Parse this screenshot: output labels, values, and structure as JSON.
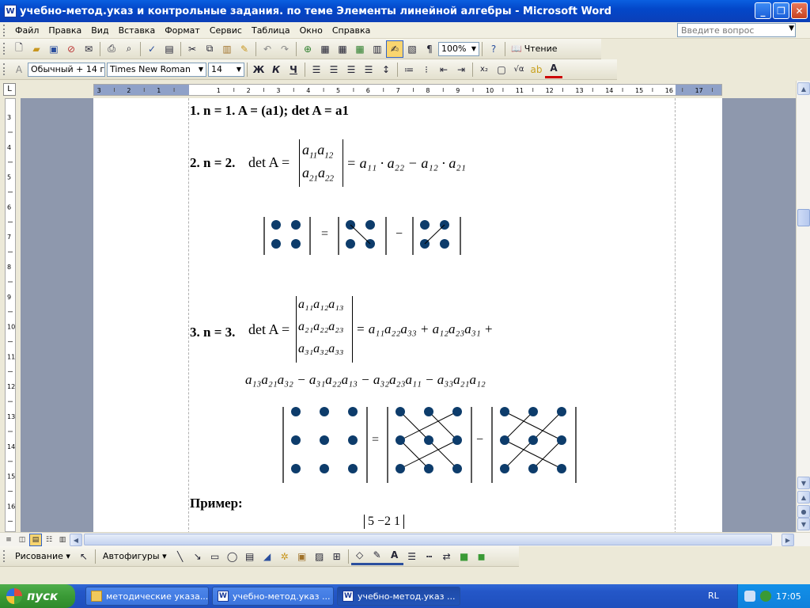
{
  "window": {
    "title": "учебно-метод.указ и контрольные задания. по теме Элементы линейной алгебры - Microsoft Word",
    "icon_letter": "W",
    "minimize": "_",
    "maximize": "❐",
    "close": "✕"
  },
  "menu": {
    "items": [
      "Файл",
      "Правка",
      "Вид",
      "Вставка",
      "Формат",
      "Сервис",
      "Таблица",
      "Окно",
      "Справка"
    ],
    "ask_placeholder": "Введите вопрос"
  },
  "standard_toolbar": {
    "zoom": "100%",
    "read_label": "Чтение"
  },
  "formatting_toolbar": {
    "style": "Обычный + 14 г",
    "font": "Times New Roman",
    "size": "14",
    "bold": "Ж",
    "italic": "К",
    "underline": "Ч",
    "font_color_letter": "A"
  },
  "ruler": {
    "corner": "L",
    "h_labels": [
      "3",
      "2",
      "1",
      "1",
      "2",
      "3",
      "4",
      "5",
      "6",
      "7",
      "8",
      "9",
      "10",
      "11",
      "12",
      "13",
      "14",
      "15",
      "16",
      "17"
    ],
    "v_labels": [
      "3",
      "4",
      "5",
      "6",
      "7",
      "8",
      "9",
      "10",
      "11",
      "12",
      "13",
      "14",
      "15",
      "16"
    ]
  },
  "document": {
    "line1": "1. n = 1. A = (a1); det A = a1",
    "item2_label": "2. n = 2.",
    "det_prefix": "det A =",
    "m2": [
      "a",
      "11",
      "a",
      "12",
      "a",
      "21",
      "a",
      "22"
    ],
    "formula2": "= a₁₁ · a₂₂ − a₁₂ · a₂₁",
    "item3_label": "3. n = 3.",
    "m3_row1": "a₁₁a₁₂a₁₃",
    "m3_row2": "a₂₁a₂₂a₂₃",
    "m3_row3": "a₃₁a₃₂a₃₃",
    "formula3a": "= a₁₁a₂₂a₃₃ + a₁₂a₂₃a₃₁ +",
    "formula3b": "a₁₃a₂₁a₃₂ − a₃₁a₂₂a₁₃ − a₃₂a₂₃a₁₁ − a₃₃a₂₁a₁₂",
    "equals": "=",
    "minus": "−",
    "example_label": "Пример:",
    "example_row": "5   −2    1"
  },
  "drawing_toolbar": {
    "drawing_label": "Рисование ▾",
    "autoshapes_label": "Автофигуры ▾",
    "font_color_letter": "A"
  },
  "taskbar": {
    "start_label": "пуск",
    "tasks": [
      "методические указа...",
      "учебно-метод.указ ...",
      "учебно-метод.указ ..."
    ],
    "lang": "RL",
    "clock": "17:05"
  },
  "colors": {
    "titlebar": "#0347c9",
    "dot": "#0d3c6b",
    "page_bg": "#8e98ad",
    "taskbar": "#2457c8",
    "start": "#3a9a36"
  }
}
